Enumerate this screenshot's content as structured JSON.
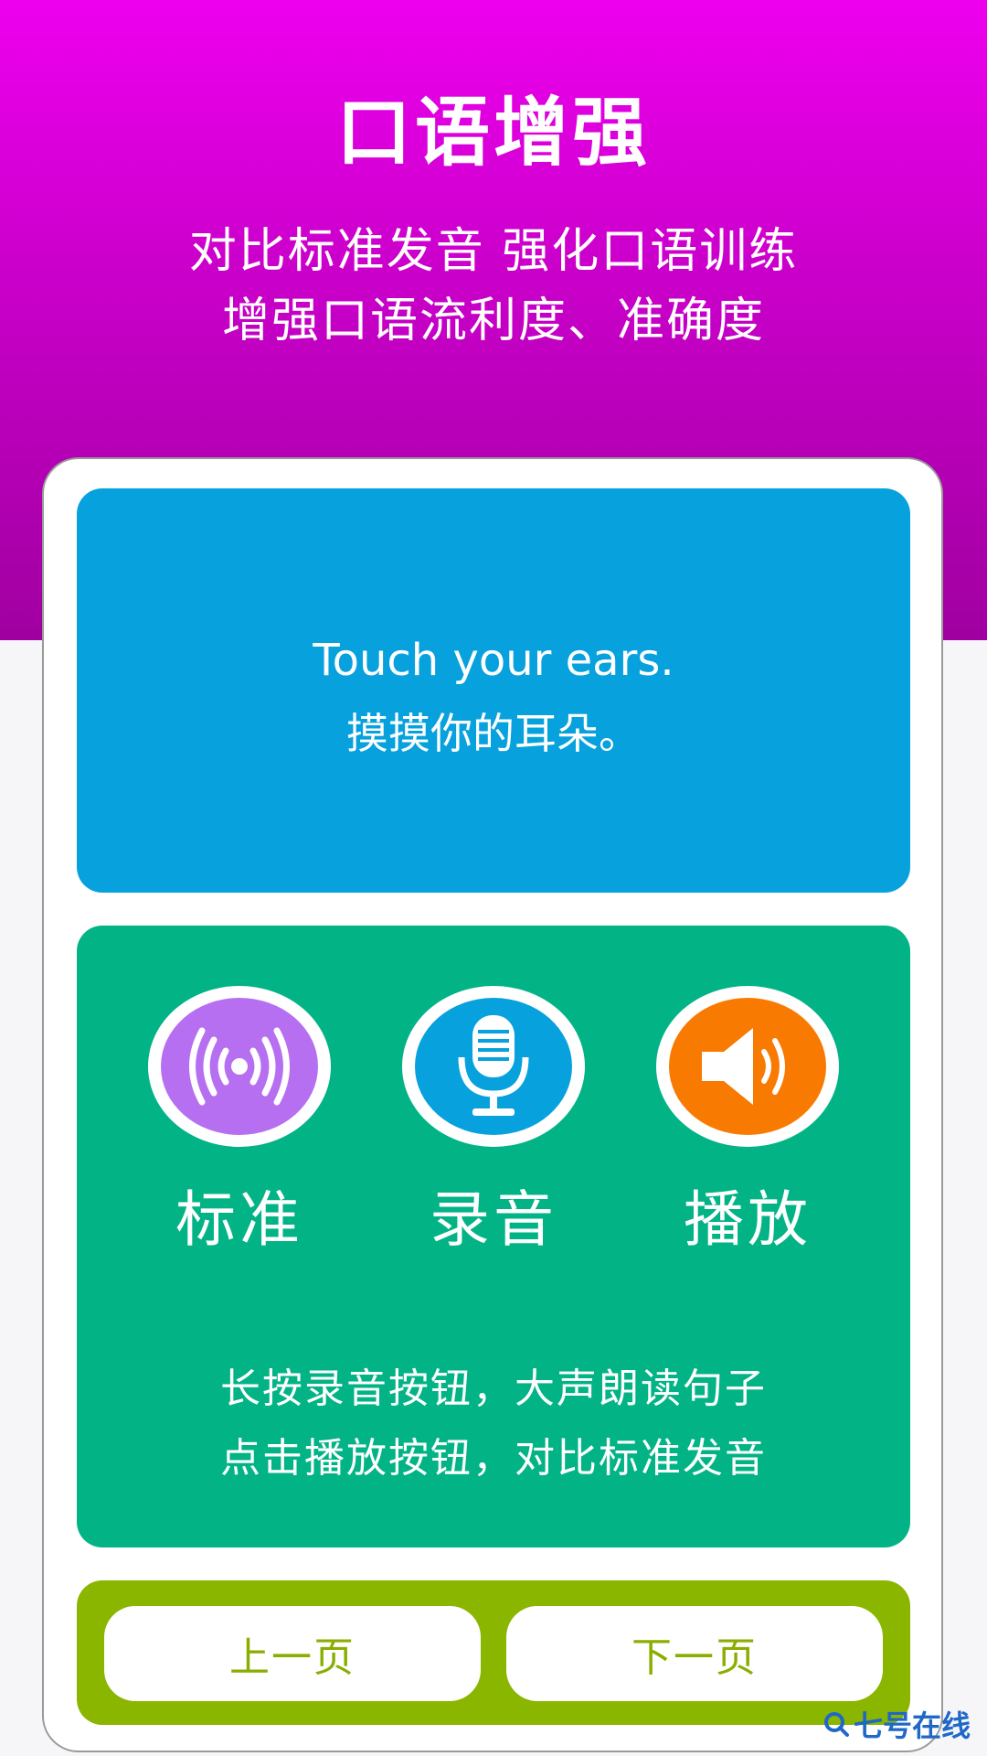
{
  "header": {
    "title": "口语增强",
    "subtitle_line1": "对比标准发音 强化口语训练",
    "subtitle_line2": "增强口语流利度、准确度"
  },
  "sentence": {
    "english": "Touch your ears.",
    "chinese": "摸摸你的耳朵。"
  },
  "controls": [
    {
      "label": "标准",
      "icon": "broadcast-icon",
      "color": "#b56ff0"
    },
    {
      "label": "录音",
      "icon": "microphone-icon",
      "color": "#07a1dd"
    },
    {
      "label": "播放",
      "icon": "speaker-icon",
      "color": "#f97a00"
    }
  ],
  "hints": {
    "line1": "长按录音按钮，大声朗读句子",
    "line2": "点击播放按钮，对比标准发音"
  },
  "nav": {
    "prev_label": "上一页",
    "next_label": "下一页"
  },
  "watermark": {
    "text": "七号在线"
  },
  "colors": {
    "hero_top": "#ee00ee",
    "hero_bottom": "#a000a0",
    "sentence_panel": "#07a1dd",
    "control_panel": "#02b385",
    "nav_panel": "#8ab600",
    "nav_text": "#8aae00"
  }
}
